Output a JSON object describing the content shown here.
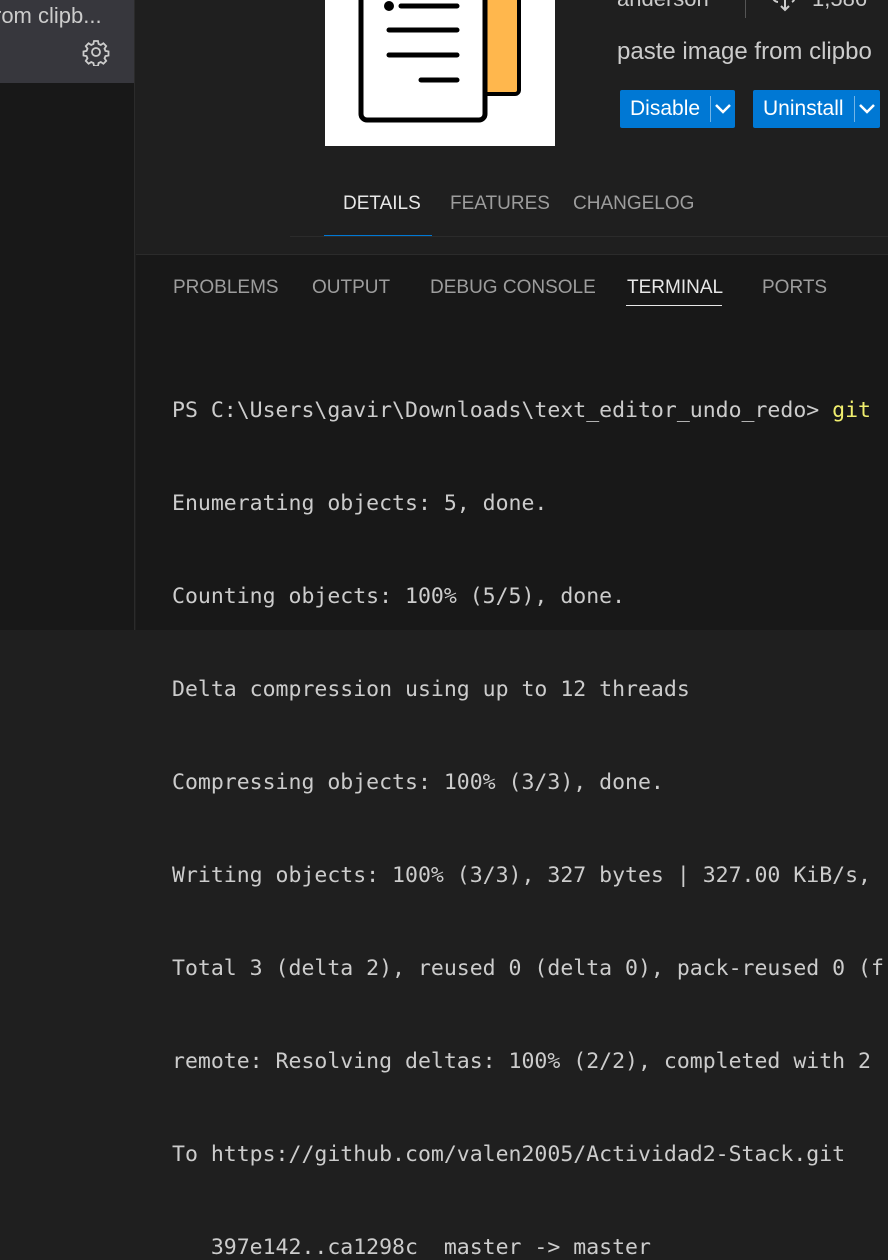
{
  "sidebar": {
    "item_label": "rom clipb...",
    "icons": [
      "gear-icon"
    ]
  },
  "extension": {
    "publisher": "anderson",
    "download_count": "1,586",
    "description": "paste image from clipbo",
    "disable_label": "Disable",
    "uninstall_label": "Uninstall",
    "tabs": [
      "DETAILS",
      "FEATURES",
      "CHANGELOG"
    ],
    "active_tab": "DETAILS",
    "accent_color": "#0078d4"
  },
  "panel": {
    "tabs": [
      "PROBLEMS",
      "OUTPUT",
      "DEBUG CONSOLE",
      "TERMINAL",
      "PORTS"
    ],
    "active_tab": "TERMINAL"
  },
  "terminal": {
    "prompt": "PS C:\\Users\\gavir\\Downloads\\text_editor_undo_redo> ",
    "command": "git",
    "lines": [
      "Enumerating objects: 5, done.",
      "Counting objects: 100% (5/5), done.",
      "Delta compression using up to 12 threads",
      "Compressing objects: 100% (3/3), done.",
      "Writing objects: 100% (3/3), 327 bytes | 327.00 KiB/s,",
      "Total 3 (delta 2), reused 0 (delta 0), pack-reused 0 (f",
      "remote: Resolving deltas: 100% (2/2), completed with 2",
      "To https://github.com/valen2005/Actividad2-Stack.git",
      "   397e142..ca1298c  master -> master"
    ]
  }
}
